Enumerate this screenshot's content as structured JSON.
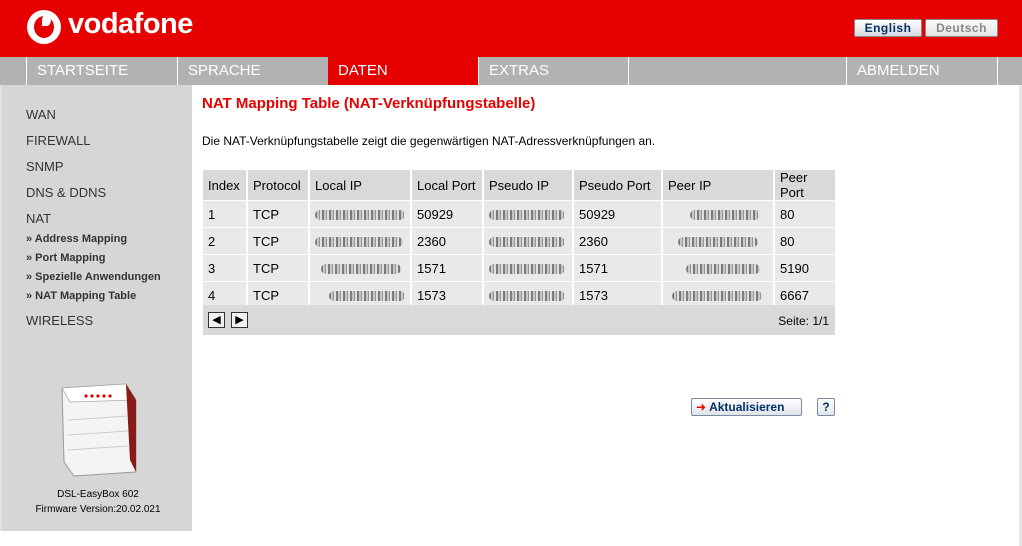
{
  "header": {
    "logo_text": "vodafone",
    "lang_english": "English",
    "lang_deutsch": "Deutsch",
    "brand_color": "#e60000"
  },
  "nav": {
    "items": [
      "STARTSEITE",
      "SPRACHE",
      "DATEN",
      "EXTRAS",
      "ABMELDEN"
    ],
    "active": "DATEN"
  },
  "sidebar": {
    "items": [
      "WAN",
      "FIREWALL",
      "SNMP",
      "DNS & DDNS",
      "NAT"
    ],
    "nat_subitems": [
      "» Address Mapping",
      "» Port Mapping",
      "» Spezielle Anwendungen",
      "» NAT Mapping Table"
    ],
    "wireless": "WIRELESS",
    "device_name": "DSL-EasyBox 602",
    "firmware": "Firmware Version:20.02.021"
  },
  "main": {
    "title": "NAT Mapping Table (NAT-Verknüpfungstabelle)",
    "description": "Die NAT-Verknüpfungstabelle zeigt die gegenwärtigen NAT-Adressverknüpfungen an.",
    "table": {
      "headers": [
        "Index",
        "Protocol",
        "Local IP",
        "Local Port",
        "Pseudo IP",
        "Pseudo Port",
        "Peer IP",
        "Peer Port"
      ],
      "rows": [
        [
          "1",
          "TCP",
          "",
          "50929",
          "",
          "50929",
          "",
          "80"
        ],
        [
          "2",
          "TCP",
          "",
          "2360",
          "",
          "2360",
          "",
          "80"
        ],
        [
          "3",
          "TCP",
          "",
          "1571",
          "",
          "1571",
          "",
          "5190"
        ],
        [
          "4",
          "TCP",
          "",
          "1573",
          "",
          "1573",
          "",
          "6667"
        ]
      ]
    },
    "page_indicator": "Seite: 1/1",
    "refresh_label": "Aktualisieren",
    "help_label": "?"
  }
}
